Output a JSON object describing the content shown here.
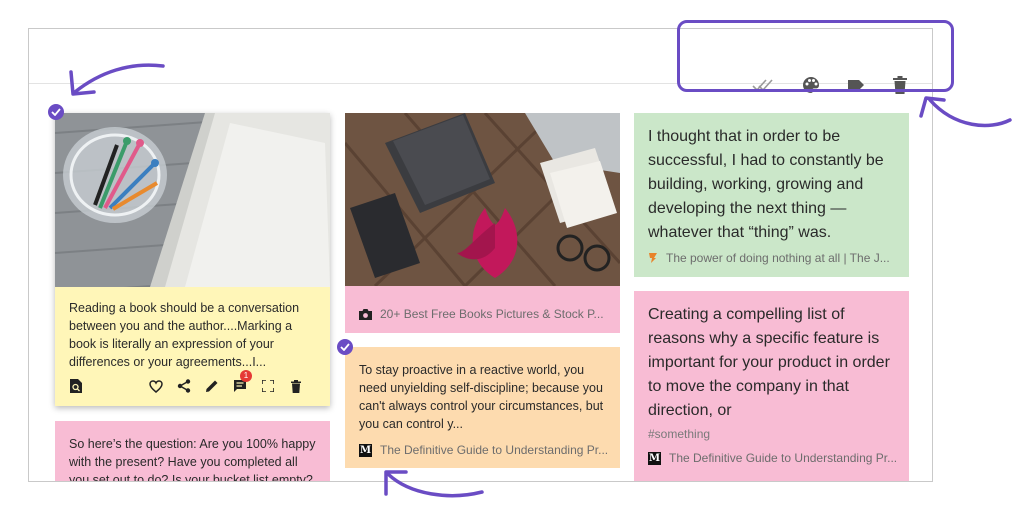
{
  "colors": {
    "accent": "#6a4cc4",
    "card_yellow": "#fff6b8",
    "card_pink": "#f8bcd4",
    "card_green": "#cbe7c9",
    "card_orange": "#fddbaf",
    "badge_red": "#e53935"
  },
  "toolbar": {
    "icons": [
      "select-all-icon",
      "palette-icon",
      "label-icon",
      "delete-icon"
    ]
  },
  "cards": {
    "book_note": {
      "text": "Reading a book should be a conversation between you and the author....Marking a book is literally an expression of your differences or your agreements...I...",
      "selected": true,
      "comment_count": "1",
      "actions": [
        "preview-icon",
        "heart-icon",
        "share-icon",
        "edit-icon",
        "comments-icon",
        "fullscreen-icon",
        "delete-icon"
      ]
    },
    "photo": {
      "source": "20+ Best Free Books Pictures & Stock P..."
    },
    "proactive": {
      "text": "To stay proactive in a reactive world, you need unyielding self-discipline; because you can't always control your circumstances, but you can control y...",
      "source": "The Definitive Guide to Understanding Pr...",
      "selected": true
    },
    "question": {
      "text": "So here’s the question: Are you 100% happy with the present? Have you completed all you set out to do? Is your bucket list empty? Or do"
    },
    "nothing": {
      "text": "I thought that in order to be successful, I had to constantly be building, working, growing and developing the next thing — whatever that “thing” was.",
      "source": "The power of doing nothing at all | The J..."
    },
    "compelling": {
      "text": "Creating a compelling list of reasons why a specific feature is important for your product in order to move the company in that direction, or",
      "tag": "#something",
      "source": "The Definitive Guide to Understanding Pr..."
    }
  }
}
